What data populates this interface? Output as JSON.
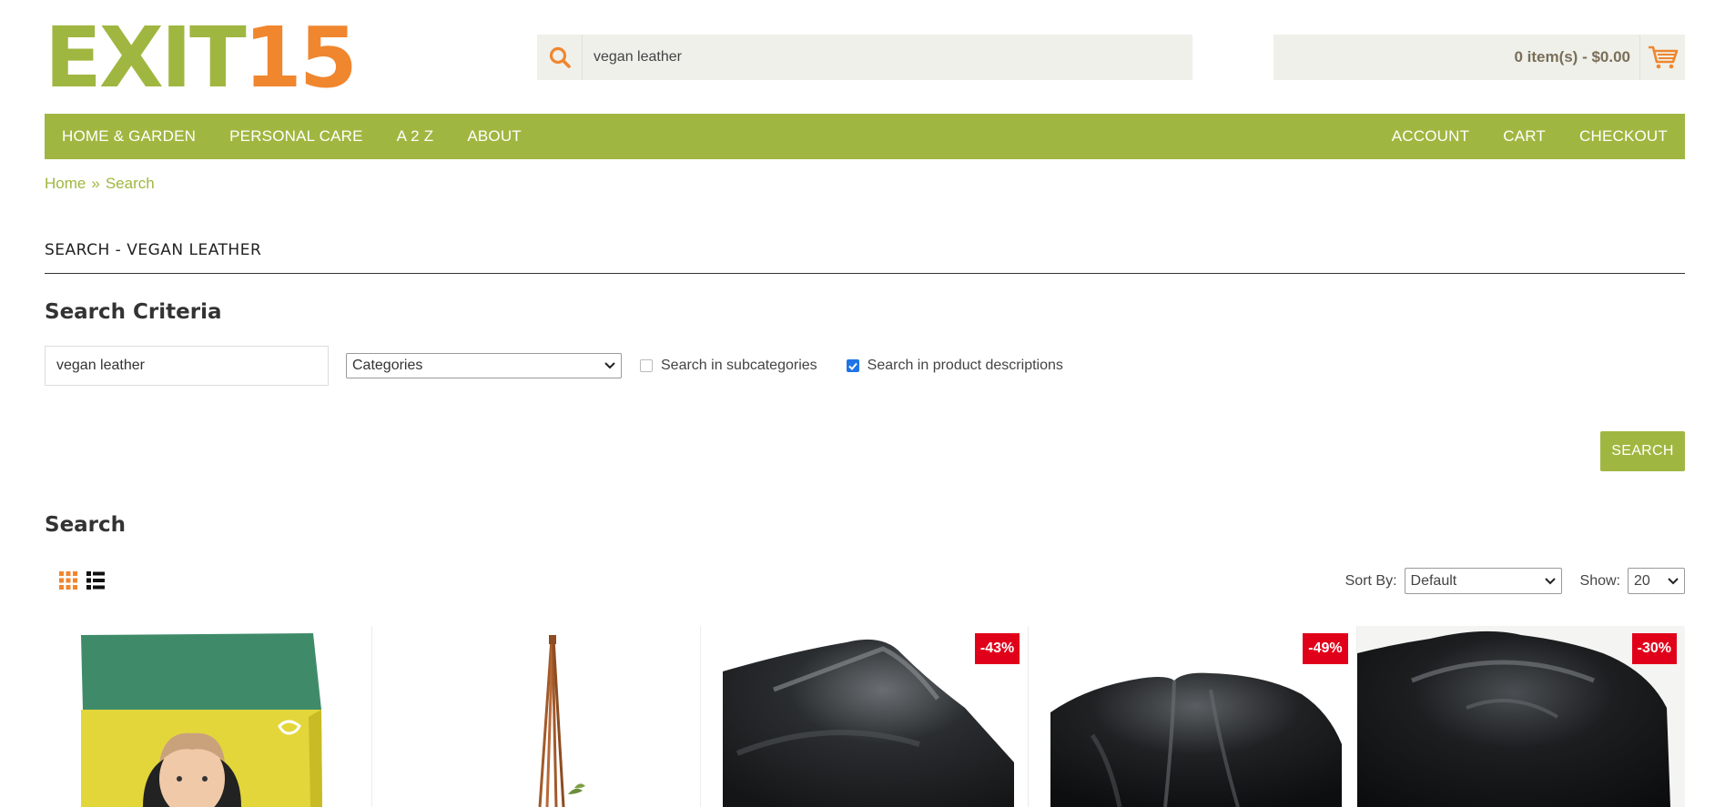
{
  "logo": {
    "part1": "EXIT",
    "part2": "15"
  },
  "header": {
    "search_value": "vegan leather",
    "cart_text": "0 item(s) - $0.00"
  },
  "nav": {
    "left": [
      "HOME & GARDEN",
      "PERSONAL CARE",
      "A 2 Z",
      "ABOUT"
    ],
    "right": [
      "ACCOUNT",
      "CART",
      "CHECKOUT"
    ]
  },
  "breadcrumb": {
    "home": "Home",
    "sep": "»",
    "current": "Search"
  },
  "page_title": "SEARCH - VEGAN LEATHER",
  "criteria": {
    "title": "Search Criteria",
    "keyword": "vegan leather",
    "category": "Categories",
    "sub_label": "Search in subcategories",
    "desc_label": "Search in product descriptions",
    "button": "SEARCH"
  },
  "results": {
    "title": "Search",
    "sort_label": "Sort By:",
    "sort_value": "Default",
    "show_label": "Show:",
    "show_value": "20"
  },
  "products": [
    {
      "badge": ""
    },
    {
      "badge": ""
    },
    {
      "badge": "-43%"
    },
    {
      "badge": "-49%"
    },
    {
      "badge": "-30%"
    }
  ],
  "colors": {
    "brand_green": "#9fb740",
    "brand_orange": "#f0862e",
    "sale_red": "#e1001a"
  }
}
